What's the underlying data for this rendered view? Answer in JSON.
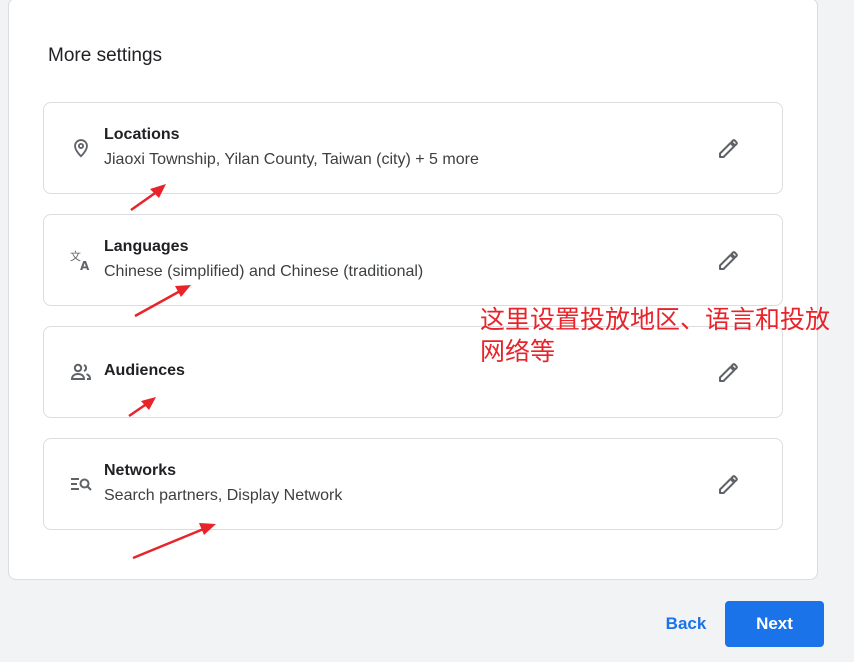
{
  "section": {
    "title": "More settings"
  },
  "settings": [
    {
      "label": "Locations",
      "value": "Jiaoxi Township, Yilan County, Taiwan (city) + 5 more",
      "icon": "location-pin-icon"
    },
    {
      "label": "Languages",
      "value": "Chinese (simplified) and Chinese (traditional)",
      "icon": "translate-icon"
    },
    {
      "label": "Audiences",
      "value": "",
      "icon": "people-icon"
    },
    {
      "label": "Networks",
      "value": "Search partners, Display Network",
      "icon": "search-list-icon"
    }
  ],
  "annotation": {
    "text": "这里设置投放地区、语言和投放网络等",
    "color": "#e8232a"
  },
  "footer": {
    "back_label": "Back",
    "next_label": "Next"
  },
  "colors": {
    "accent": "#1a73e8",
    "annotation": "#e8232a"
  }
}
